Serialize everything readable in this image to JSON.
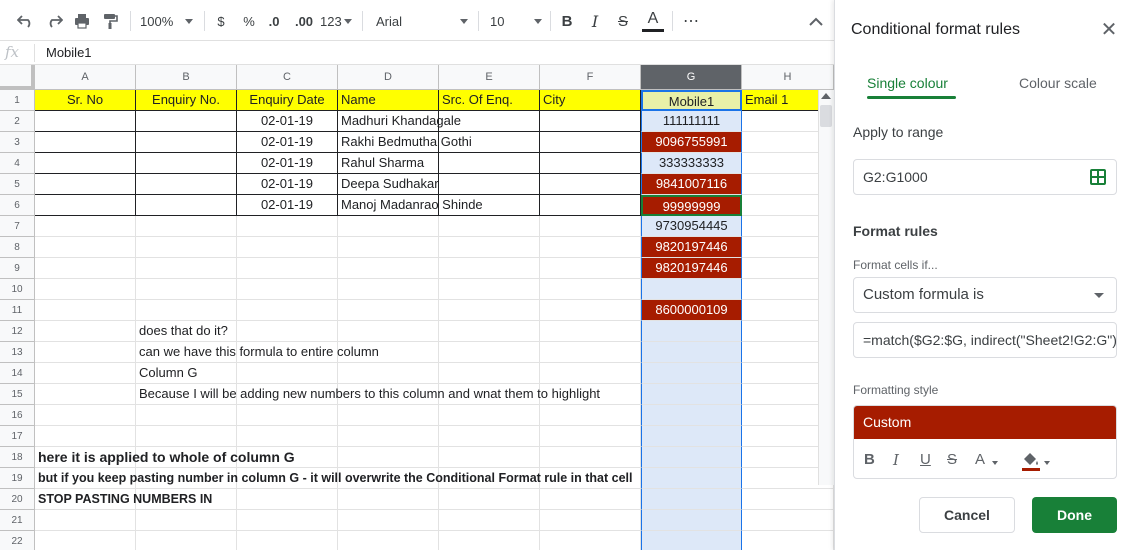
{
  "toolbar": {
    "zoom": "100%",
    "currency": "$",
    "percent": "%",
    "decrease_decimal": ".0",
    "increase_decimal": ".00",
    "number_format": "123",
    "font": "Arial",
    "font_size": "10",
    "bold": "B",
    "italic": "I",
    "strikethrough": "S",
    "text_color": "A",
    "more": "⋯"
  },
  "formula_bar": {
    "fx": "fx",
    "value": "Mobile1"
  },
  "columns": [
    "A",
    "B",
    "C",
    "D",
    "E",
    "F",
    "G",
    "H"
  ],
  "header_row": [
    "Sr. No",
    "Enquiry No.",
    "Enquiry Date",
    "Name",
    "Src. Of Enq.",
    "City",
    "Mobile1",
    "Email 1"
  ],
  "rows": [
    {
      "num": "1"
    },
    {
      "num": "2",
      "date": "02-01-19",
      "name": "Madhuri Khandagale",
      "mobile": "111111111"
    },
    {
      "num": "3",
      "date": "02-01-19",
      "name": "Rakhi Bedmutha Gothi",
      "mobile": "9096755991"
    },
    {
      "num": "4",
      "date": "02-01-19",
      "name": "Rahul Sharma",
      "mobile": "333333333"
    },
    {
      "num": "5",
      "date": "02-01-19",
      "name": "Deepa Sudhakar",
      "mobile": "9841007116"
    },
    {
      "num": "6",
      "date": "02-01-19",
      "name": "Manoj Madanrao Shinde",
      "mobile": "99999999"
    },
    {
      "num": "7",
      "mobile": "9730954445"
    },
    {
      "num": "8",
      "mobile": "9820197446"
    },
    {
      "num": "9",
      "mobile": "9820197446"
    },
    {
      "num": "10"
    },
    {
      "num": "11",
      "mobile": "8600000109"
    },
    {
      "num": "12",
      "note": "does that do it?"
    },
    {
      "num": "13",
      "note": "can we have this formula to entire column"
    },
    {
      "num": "14",
      "note": "Column G"
    },
    {
      "num": "15",
      "note": "Because I will be adding new numbers to this column and wnat them to highlight"
    },
    {
      "num": "16"
    },
    {
      "num": "17"
    },
    {
      "num": "18",
      "bold": "here it is applied to whole of column G"
    },
    {
      "num": "19",
      "bold": "but if you keep pasting number in column G - it will overwrite the Conditional Format rule in that cell"
    },
    {
      "num": "20",
      "bold": "STOP PASTING NUMBERS IN"
    },
    {
      "num": "21"
    },
    {
      "num": "22"
    }
  ],
  "colors": {
    "header_yellow": "#ffff00",
    "highlight_red": "#a61c00",
    "column_blue": "#dde8f8",
    "accent_green": "#188038"
  },
  "panel": {
    "title": "Conditional format rules",
    "close": "✕",
    "tabs": [
      "Single colour",
      "Colour scale"
    ],
    "apply_label": "Apply to range",
    "range": "G2:G1000",
    "format_rules_label": "Format rules",
    "format_if_label": "Format cells if...",
    "condition": "Custom formula is",
    "formula": "=match($G2:$G, indirect(\"Sheet2!G2:G\")",
    "formatting_style_label": "Formatting style",
    "style_name": "Custom",
    "style_buttons": {
      "bold": "B",
      "italic": "I",
      "underline": "U",
      "strike": "S",
      "text_color": "A"
    },
    "cancel": "Cancel",
    "done": "Done"
  }
}
